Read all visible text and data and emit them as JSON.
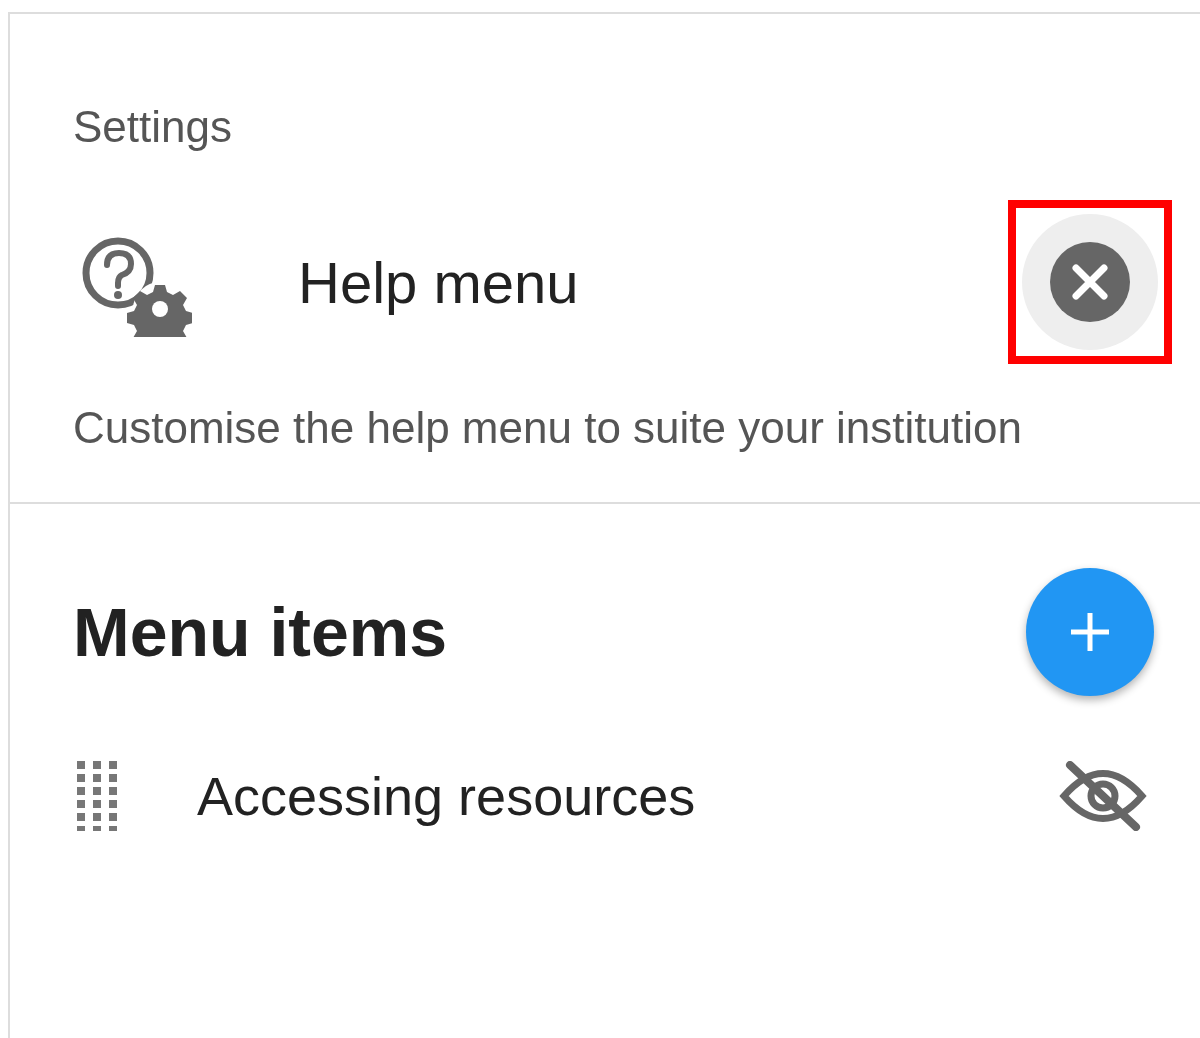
{
  "section_label": "Settings",
  "setting": {
    "title": "Help menu",
    "description": "Customise the help menu to suite your institution",
    "close_highlighted": true
  },
  "menu": {
    "title": "Menu items",
    "items": [
      {
        "label": "Accessing resources",
        "visible": false
      }
    ]
  }
}
